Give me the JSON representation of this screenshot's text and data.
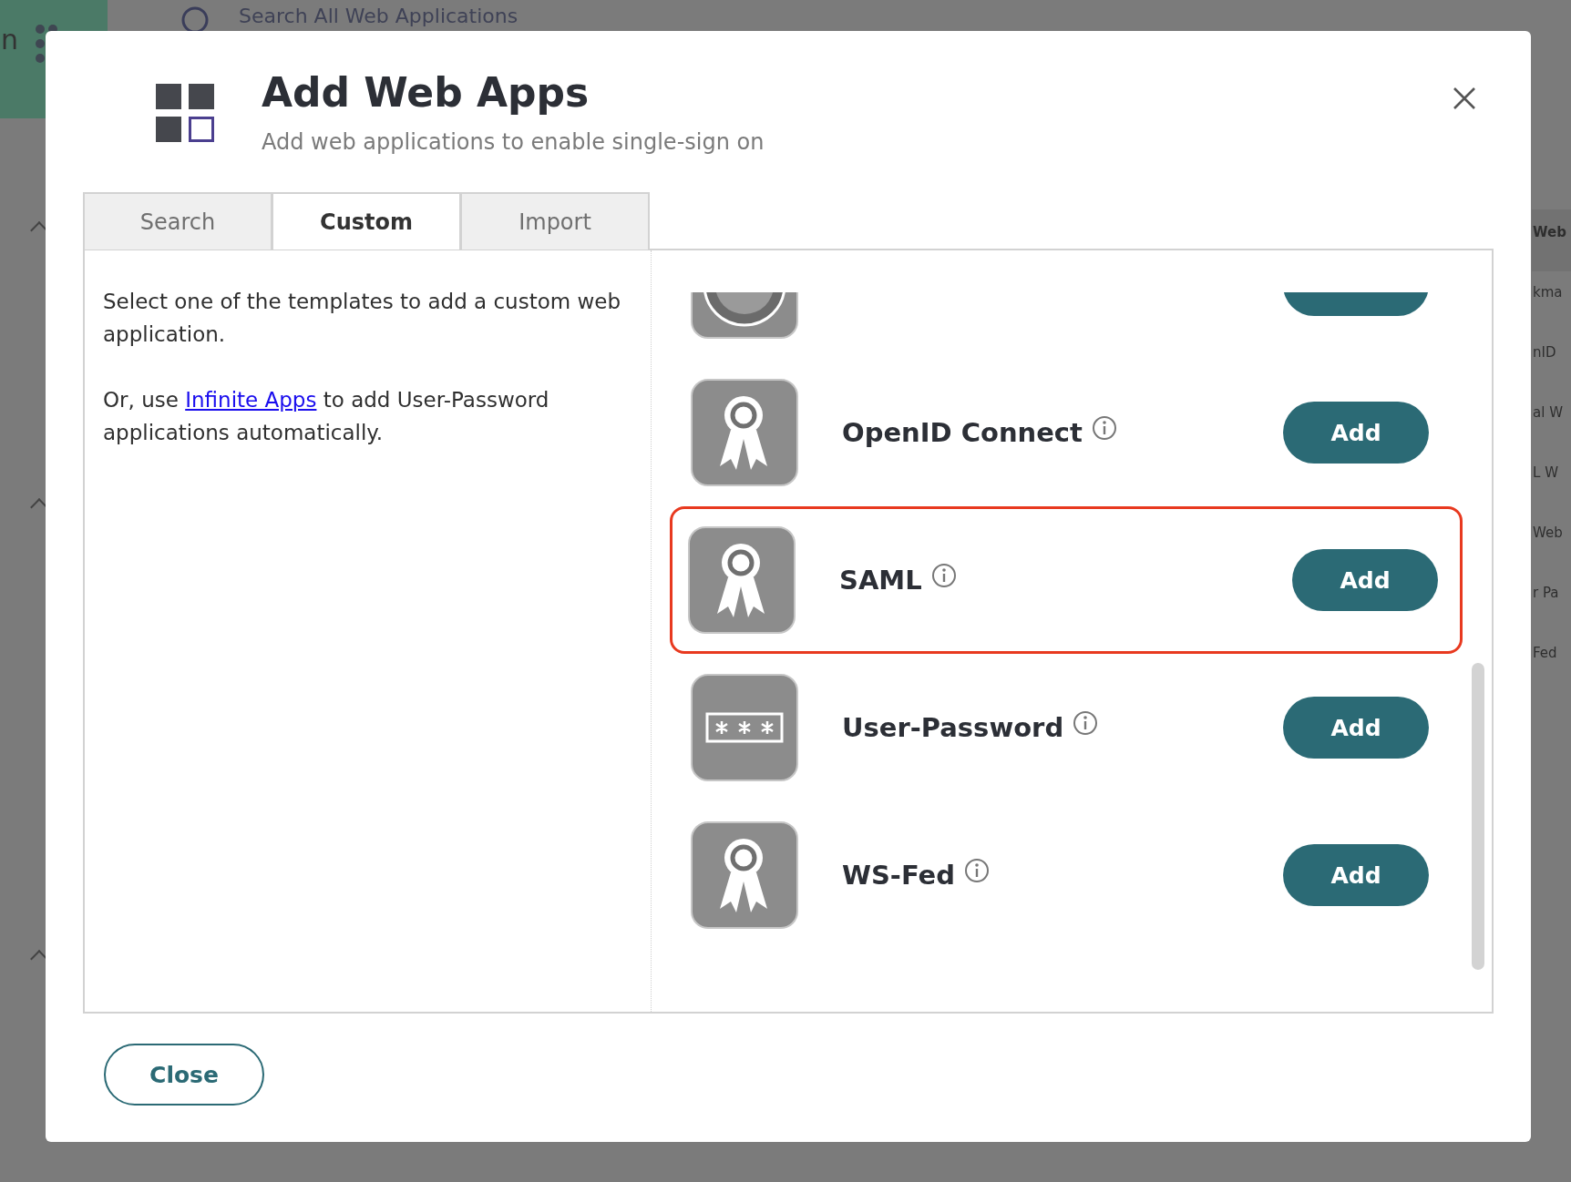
{
  "backdrop": {
    "sidebar_text": "n",
    "search": {
      "placeholder": "Search All Web Applications"
    },
    "right_column": [
      "Web",
      "kma",
      "nID",
      "al W",
      "L W",
      "Web",
      "r Pa",
      "Fed"
    ]
  },
  "dialog": {
    "title": "Add Web Apps",
    "subtitle": "Add web applications to enable single-sign on",
    "tabs": [
      {
        "label": "Search",
        "selected": false
      },
      {
        "label": "Custom",
        "selected": true
      },
      {
        "label": "Import",
        "selected": false
      }
    ],
    "intro": "Select one of the templates to add a custom web application.",
    "hint": {
      "before": "Or, use ",
      "link": "Infinite Apps",
      "after": " to add User-Password applications automatically."
    },
    "templates": [
      {
        "kind": "oauth",
        "highlighted": false
      },
      {
        "name": "OpenID Connect",
        "kind": "certificate",
        "button": "Add",
        "highlighted": false
      },
      {
        "name": "SAML",
        "kind": "certificate",
        "button": "Add",
        "highlighted": true
      },
      {
        "name": "User-Password",
        "kind": "password",
        "button": "Add",
        "highlighted": false
      },
      {
        "name": "WS-Fed",
        "kind": "certificate",
        "button": "Add",
        "highlighted": false
      }
    ],
    "close_button": "Close"
  }
}
